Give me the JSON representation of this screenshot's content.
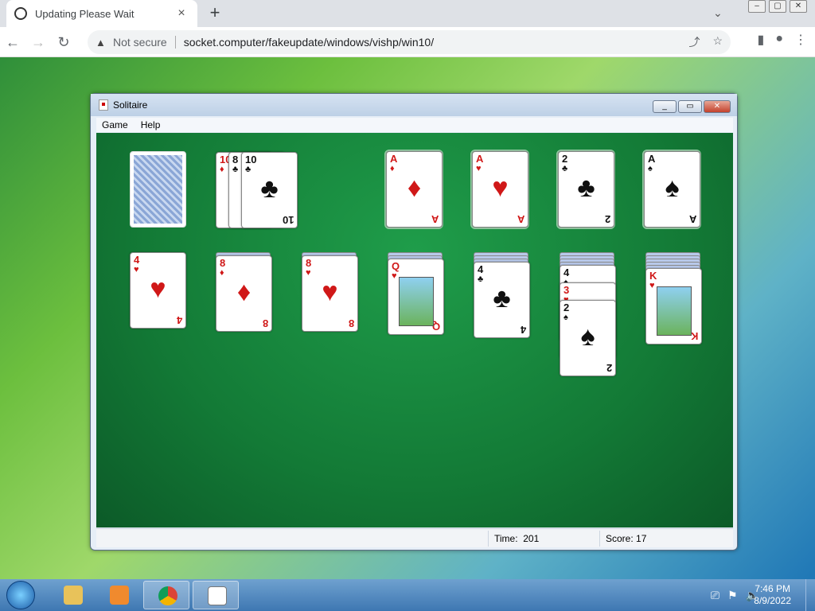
{
  "browser": {
    "tab_title": "Updating Please Wait",
    "tab_close": "×",
    "new_tab": "+",
    "not_secure": "Not secure",
    "url": "socket.computer/fakeupdate/windows/vishp/win10/"
  },
  "window": {
    "title": "Solitaire",
    "menu": [
      "Game",
      "Help"
    ]
  },
  "status": {
    "time_label": "Time:",
    "time_value": "201",
    "score_label": "Score:",
    "score_value": "17"
  },
  "stock": {
    "label": "stock",
    "count": 1
  },
  "waste": [
    {
      "rank": "10",
      "suit": "♦"
    },
    {
      "rank": "8",
      "suit": "♣"
    },
    {
      "rank": "10",
      "suit": "♣"
    }
  ],
  "foundations": [
    {
      "rank": "A",
      "suit": "♦",
      "color": "red"
    },
    {
      "rank": "A",
      "suit": "♥",
      "color": "red"
    },
    {
      "rank": "2",
      "suit": "♣",
      "color": "blk"
    },
    {
      "rank": "A",
      "suit": "♠",
      "color": "blk"
    }
  ],
  "tableau": [
    {
      "hidden": 0,
      "cards": [
        {
          "rank": "4",
          "suit": "♥",
          "color": "red"
        }
      ]
    },
    {
      "hidden": 1,
      "cards": [
        {
          "rank": "8",
          "suit": "♦",
          "color": "red"
        }
      ]
    },
    {
      "hidden": 1,
      "cards": [
        {
          "rank": "8",
          "suit": "♥",
          "color": "red"
        }
      ]
    },
    {
      "hidden": 2,
      "cards": [
        {
          "rank": "Q",
          "suit": "♥",
          "color": "red",
          "face": true
        }
      ]
    },
    {
      "hidden": 3,
      "cards": [
        {
          "rank": "4",
          "suit": "♣",
          "color": "blk"
        }
      ]
    },
    {
      "hidden": 4,
      "cards": [
        {
          "rank": "4",
          "suit": "♠",
          "color": "blk"
        },
        {
          "rank": "3",
          "suit": "♥",
          "color": "red"
        },
        {
          "rank": "2",
          "suit": "♠",
          "color": "blk"
        }
      ]
    },
    {
      "hidden": 5,
      "cards": [
        {
          "rank": "K",
          "suit": "♥",
          "color": "red",
          "face": true
        }
      ]
    }
  ],
  "taskbar": {
    "time": "7:46 PM",
    "date": "8/9/2022"
  }
}
